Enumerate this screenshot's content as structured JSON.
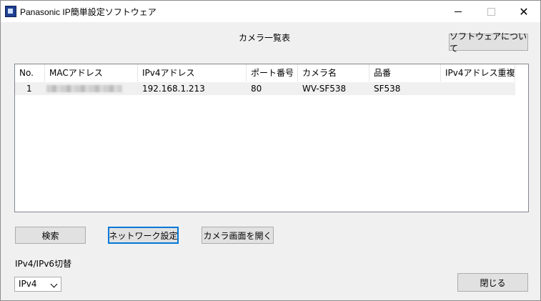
{
  "window": {
    "title": "Panasonic IP簡単設定ソフトウェア"
  },
  "header": {
    "label": "カメラ一覧表",
    "about_button": "ソフトウェアについて"
  },
  "table": {
    "columns": [
      "No.",
      "MACアドレス",
      "IPv4アドレス",
      "ポート番号",
      "カメラ名",
      "品番",
      "IPv4アドレス重複"
    ],
    "rows": [
      {
        "no": "1",
        "mac": "",
        "ipv4": "192.168.1.213",
        "port": "80",
        "name": "WV-SF538",
        "model": "SF538",
        "dup": ""
      }
    ]
  },
  "buttons": {
    "search": "検索",
    "network_settings": "ネットワーク設定",
    "open_camera": "カメラ画面を開く",
    "close": "閉じる"
  },
  "mode": {
    "label": "IPv4/IPv6切替",
    "selected": "IPv4"
  }
}
